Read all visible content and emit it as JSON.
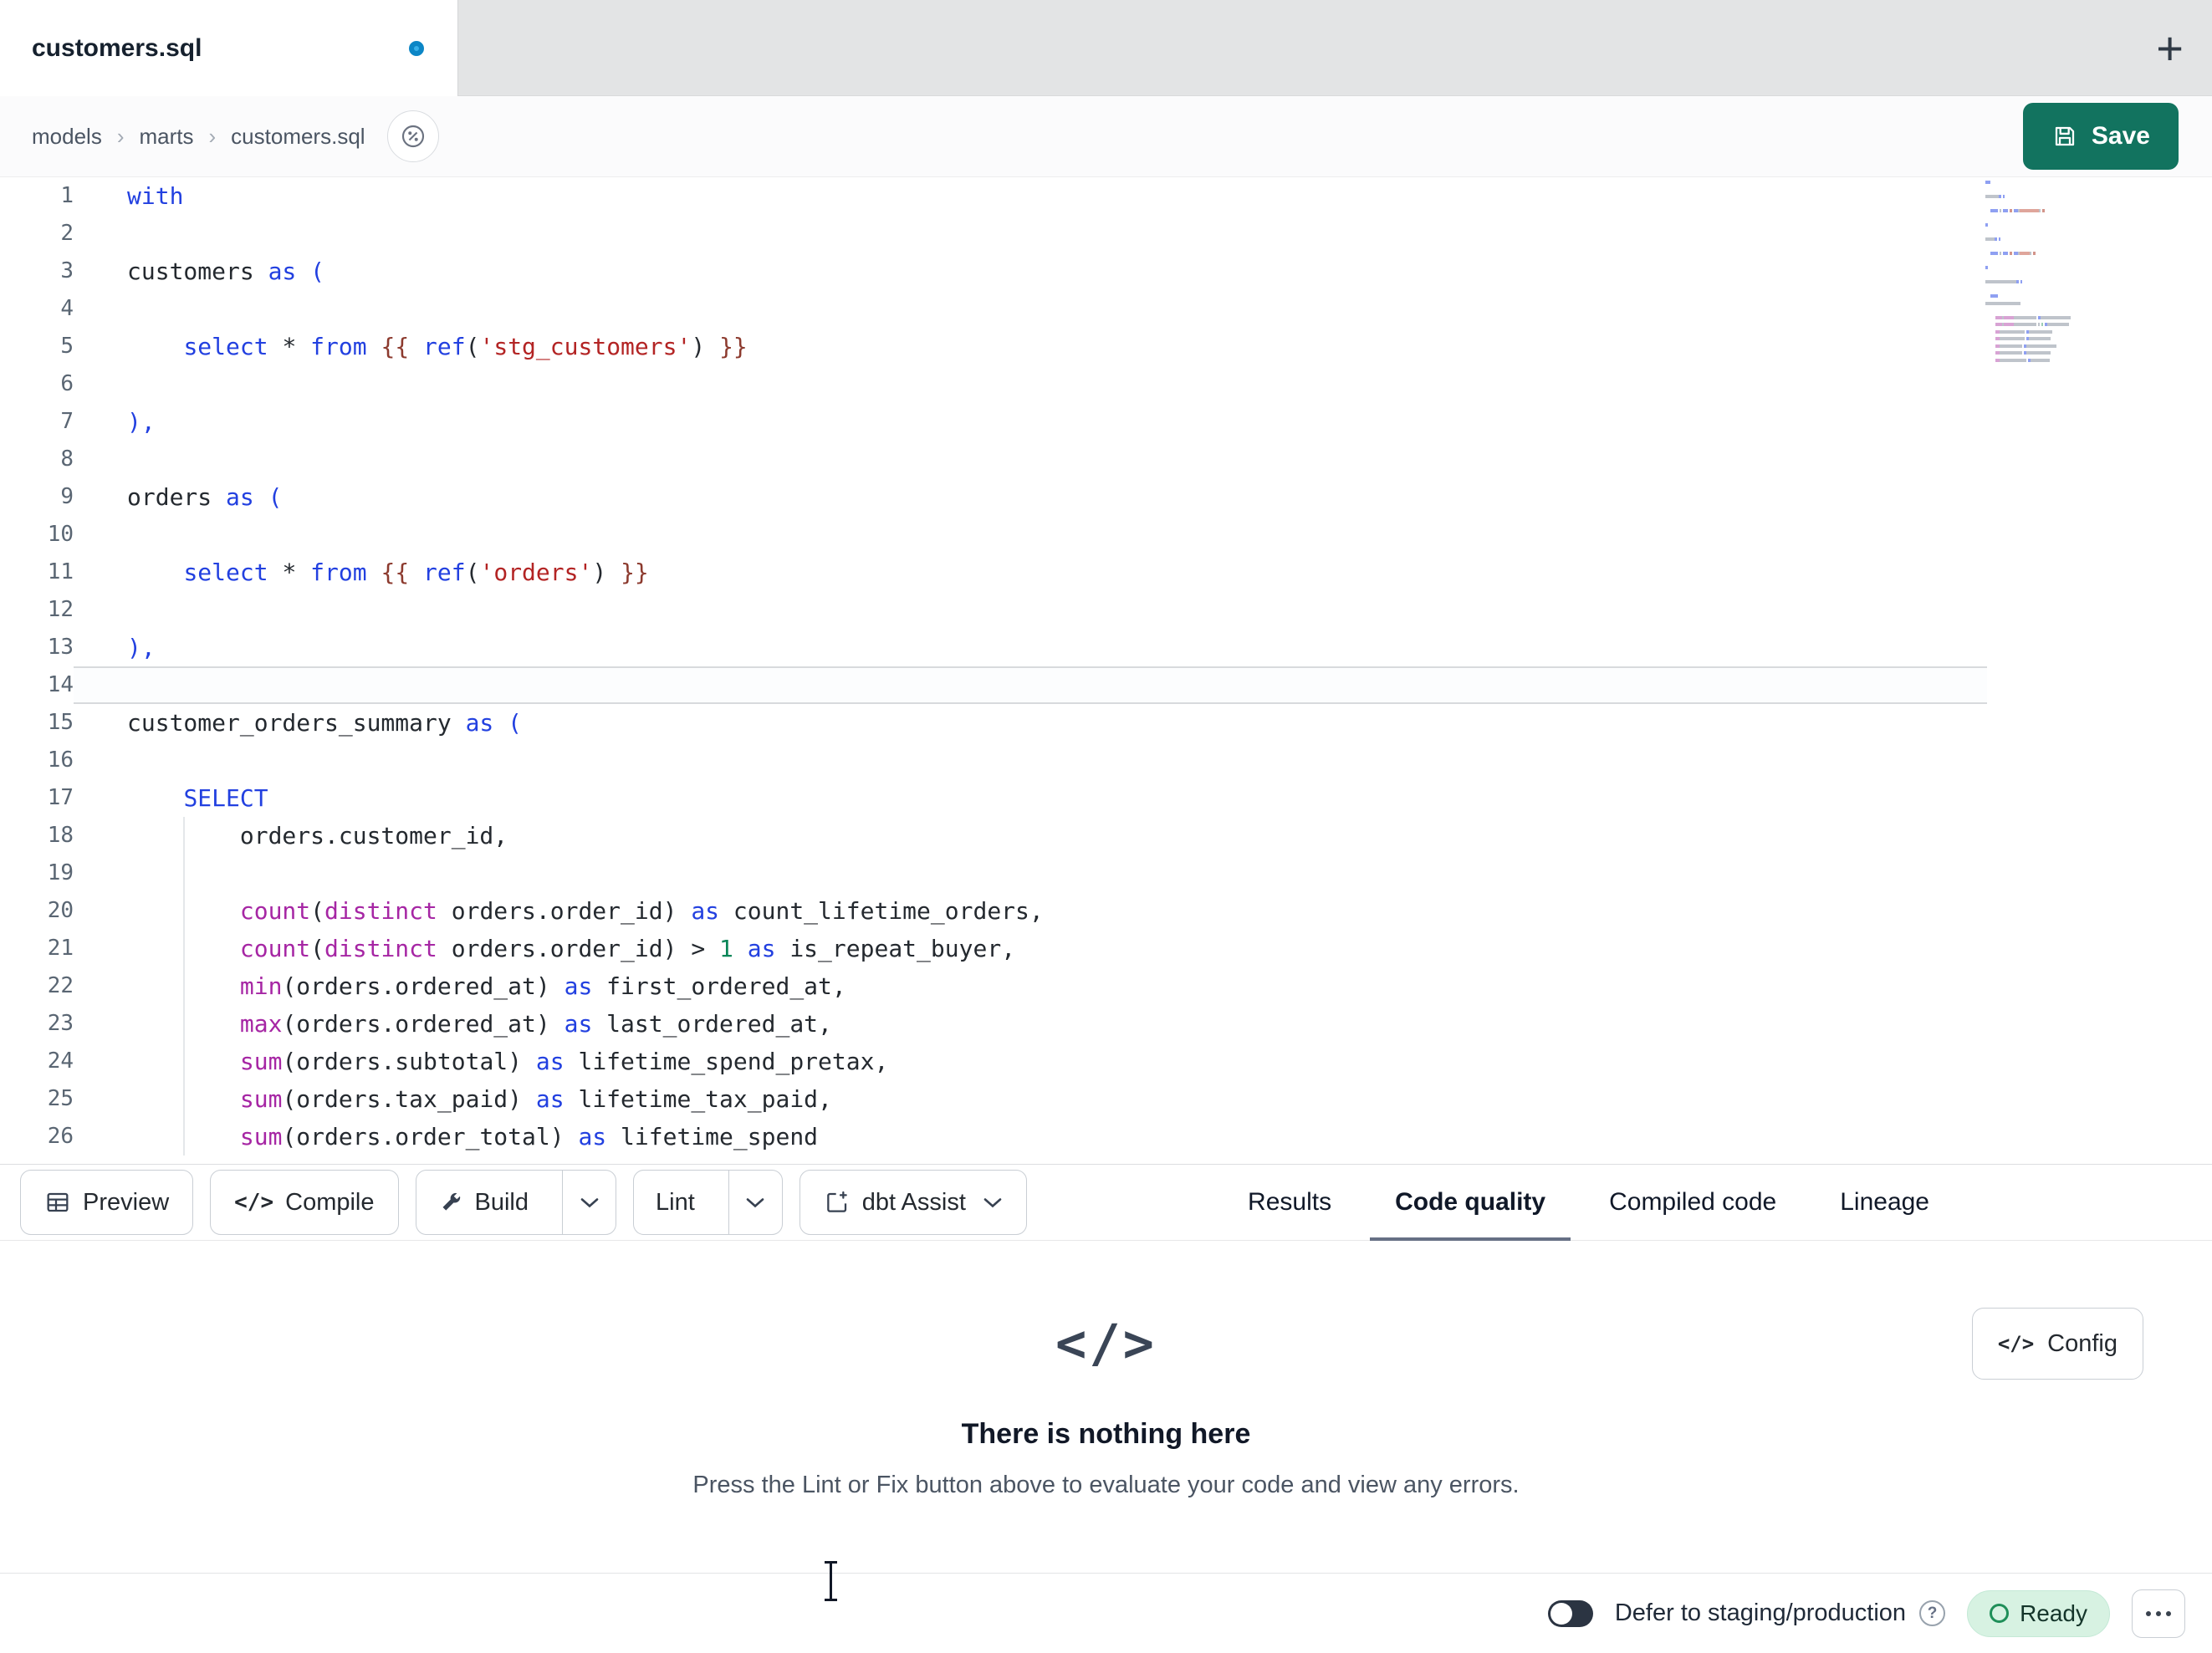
{
  "tab_bar": {
    "active_tab": "customers.sql",
    "new_tab": "+"
  },
  "breadcrumb": {
    "items": [
      "models",
      "marts",
      "customers.sql"
    ],
    "separator": "›"
  },
  "actions": {
    "save": "Save"
  },
  "editor": {
    "active_line": 14,
    "lines": [
      {
        "n": 1,
        "tokens": [
          [
            "kw",
            "with"
          ]
        ]
      },
      {
        "n": 2,
        "tokens": []
      },
      {
        "n": 3,
        "tokens": [
          [
            "t",
            "customers "
          ],
          [
            "kw",
            "as"
          ],
          [
            "t",
            " "
          ],
          [
            "pb",
            "("
          ]
        ]
      },
      {
        "n": 4,
        "tokens": []
      },
      {
        "n": 5,
        "tokens": [
          [
            "t",
            "    "
          ],
          [
            "kw",
            "select"
          ],
          [
            "t",
            " "
          ],
          [
            "op",
            "*"
          ],
          [
            "t",
            " "
          ],
          [
            "kw",
            "from"
          ],
          [
            "t",
            " "
          ],
          [
            "jinja",
            "{{"
          ],
          [
            "t",
            " "
          ],
          [
            "kw",
            "ref"
          ],
          [
            "t",
            "("
          ],
          [
            "str",
            "'stg_customers'"
          ],
          [
            "t",
            ")"
          ],
          [
            "t",
            " "
          ],
          [
            "jinja",
            "}}"
          ]
        ]
      },
      {
        "n": 6,
        "tokens": []
      },
      {
        "n": 7,
        "tokens": [
          [
            "pb",
            "),"
          ]
        ]
      },
      {
        "n": 8,
        "tokens": []
      },
      {
        "n": 9,
        "tokens": [
          [
            "t",
            "orders "
          ],
          [
            "kw",
            "as"
          ],
          [
            "t",
            " "
          ],
          [
            "pb",
            "("
          ]
        ]
      },
      {
        "n": 10,
        "tokens": []
      },
      {
        "n": 11,
        "tokens": [
          [
            "t",
            "    "
          ],
          [
            "kw",
            "select"
          ],
          [
            "t",
            " "
          ],
          [
            "op",
            "*"
          ],
          [
            "t",
            " "
          ],
          [
            "kw",
            "from"
          ],
          [
            "t",
            " "
          ],
          [
            "jinja",
            "{{"
          ],
          [
            "t",
            " "
          ],
          [
            "kw",
            "ref"
          ],
          [
            "t",
            "("
          ],
          [
            "str",
            "'orders'"
          ],
          [
            "t",
            ")"
          ],
          [
            "t",
            " "
          ],
          [
            "jinja",
            "}}"
          ]
        ]
      },
      {
        "n": 12,
        "tokens": []
      },
      {
        "n": 13,
        "tokens": [
          [
            "pb",
            "),"
          ]
        ]
      },
      {
        "n": 14,
        "tokens": []
      },
      {
        "n": 15,
        "tokens": [
          [
            "t",
            "customer_orders_summary "
          ],
          [
            "kw",
            "as"
          ],
          [
            "t",
            " "
          ],
          [
            "pb",
            "("
          ]
        ]
      },
      {
        "n": 16,
        "tokens": []
      },
      {
        "n": 17,
        "tokens": [
          [
            "t",
            "    "
          ],
          [
            "kw",
            "SELECT"
          ]
        ]
      },
      {
        "n": 18,
        "tokens": [
          [
            "t",
            "        orders.customer_id,"
          ]
        ]
      },
      {
        "n": 19,
        "tokens": []
      },
      {
        "n": 20,
        "tokens": [
          [
            "t",
            "        "
          ],
          [
            "fn",
            "count"
          ],
          [
            "t",
            "("
          ],
          [
            "fn",
            "distinct"
          ],
          [
            "t",
            " orders.order_id"
          ],
          [
            "t",
            ")"
          ],
          [
            "t",
            " "
          ],
          [
            "kw",
            "as"
          ],
          [
            "t",
            " count_lifetime_orders,"
          ]
        ]
      },
      {
        "n": 21,
        "tokens": [
          [
            "t",
            "        "
          ],
          [
            "fn",
            "count"
          ],
          [
            "t",
            "("
          ],
          [
            "fn",
            "distinct"
          ],
          [
            "t",
            " orders.order_id"
          ],
          [
            "t",
            ")"
          ],
          [
            "t",
            " "
          ],
          [
            "op",
            ">"
          ],
          [
            "t",
            " "
          ],
          [
            "num",
            "1"
          ],
          [
            "t",
            " "
          ],
          [
            "kw",
            "as"
          ],
          [
            "t",
            " is_repeat_buyer,"
          ]
        ]
      },
      {
        "n": 22,
        "tokens": [
          [
            "t",
            "        "
          ],
          [
            "fn",
            "min"
          ],
          [
            "t",
            "("
          ],
          [
            "t",
            "orders.ordered_at"
          ],
          [
            "t",
            ")"
          ],
          [
            "t",
            " "
          ],
          [
            "kw",
            "as"
          ],
          [
            "t",
            " first_ordered_at,"
          ]
        ]
      },
      {
        "n": 23,
        "tokens": [
          [
            "t",
            "        "
          ],
          [
            "fn",
            "max"
          ],
          [
            "t",
            "("
          ],
          [
            "t",
            "orders.ordered_at"
          ],
          [
            "t",
            ")"
          ],
          [
            "t",
            " "
          ],
          [
            "kw",
            "as"
          ],
          [
            "t",
            " last_ordered_at,"
          ]
        ]
      },
      {
        "n": 24,
        "tokens": [
          [
            "t",
            "        "
          ],
          [
            "fn",
            "sum"
          ],
          [
            "t",
            "("
          ],
          [
            "t",
            "orders.subtotal"
          ],
          [
            "t",
            ")"
          ],
          [
            "t",
            " "
          ],
          [
            "kw",
            "as"
          ],
          [
            "t",
            " lifetime_spend_pretax,"
          ]
        ]
      },
      {
        "n": 25,
        "tokens": [
          [
            "t",
            "        "
          ],
          [
            "fn",
            "sum"
          ],
          [
            "t",
            "("
          ],
          [
            "t",
            "orders.tax_paid"
          ],
          [
            "t",
            ")"
          ],
          [
            "t",
            " "
          ],
          [
            "kw",
            "as"
          ],
          [
            "t",
            " lifetime_tax_paid,"
          ]
        ]
      },
      {
        "n": 26,
        "tokens": [
          [
            "t",
            "        "
          ],
          [
            "fn",
            "sum"
          ],
          [
            "t",
            "("
          ],
          [
            "t",
            "orders.order_total"
          ],
          [
            "t",
            ")"
          ],
          [
            "t",
            " "
          ],
          [
            "kw",
            "as"
          ],
          [
            "t",
            " lifetime_spend"
          ]
        ]
      }
    ]
  },
  "toolbar": {
    "preview": "Preview",
    "compile": "Compile",
    "compile_icon": "</>",
    "build": "Build",
    "lint": "Lint",
    "dbt_assist": "dbt Assist"
  },
  "panel_tabs": [
    {
      "label": "Results",
      "active": false
    },
    {
      "label": "Code quality",
      "active": true
    },
    {
      "label": "Compiled code",
      "active": false
    },
    {
      "label": "Lineage",
      "active": false
    }
  ],
  "results": {
    "empty_icon": "</>",
    "title": "There is nothing here",
    "subtitle": "Press the Lint or Fix button above to evaluate your code and view any errors.",
    "config_icon": "</>",
    "config": "Config"
  },
  "status_bar": {
    "defer_label": "Defer to staging/production",
    "help_icon": "?",
    "ready": "Ready"
  },
  "colors": {
    "save_bg": "#12735f",
    "keyword": "#2240e0",
    "function": "#a626a4",
    "string": "#b32424",
    "jinja": "#8c3a2e",
    "number": "#098658",
    "modified_dot": "#39b1ea",
    "ready_bg": "#d7f2e2",
    "ready_icon": "#1f8f59"
  }
}
